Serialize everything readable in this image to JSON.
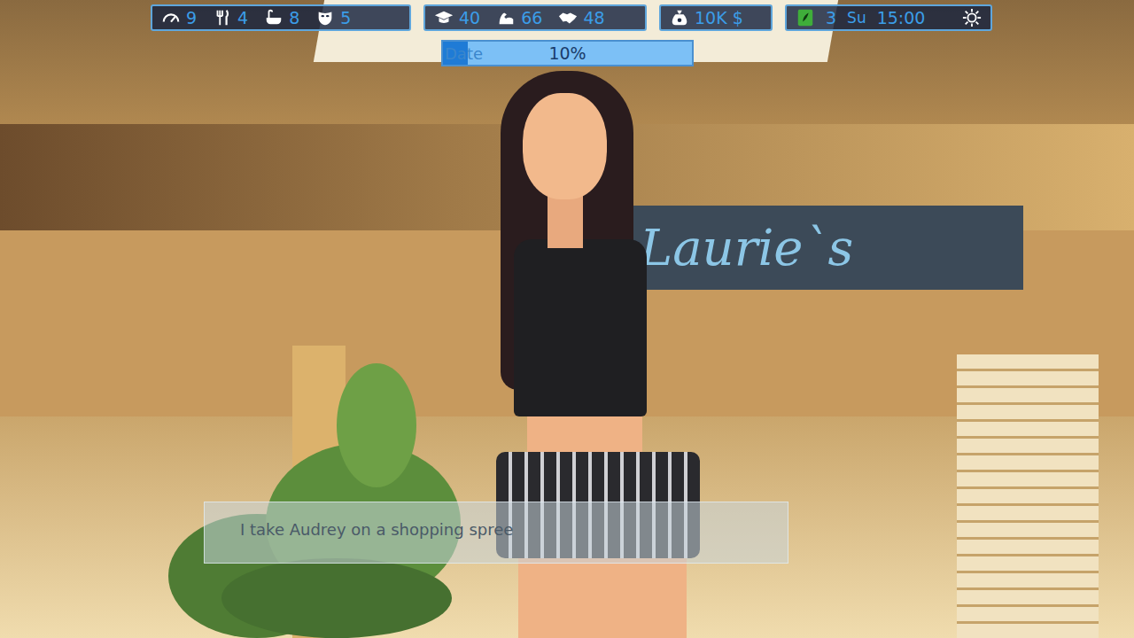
{
  "hud": {
    "groups": [
      {
        "stats": [
          {
            "value": "9"
          },
          {
            "value": "4"
          },
          {
            "value": "8"
          },
          {
            "value": "5"
          }
        ]
      },
      {
        "stats": [
          {
            "value": "40"
          },
          {
            "value": "66"
          },
          {
            "value": "48"
          }
        ]
      },
      {
        "stats": [
          {
            "value": "10K $"
          }
        ]
      }
    ],
    "calendar": {
      "day_number": "3",
      "day": "Su",
      "time": "15:00"
    }
  },
  "date_bar": {
    "label": "Date",
    "reading": "10%",
    "level": 0.1
  },
  "scene": {
    "sign": "Laurie`s"
  },
  "dialog": {
    "text": "I take Audrey on a shopping spree"
  }
}
